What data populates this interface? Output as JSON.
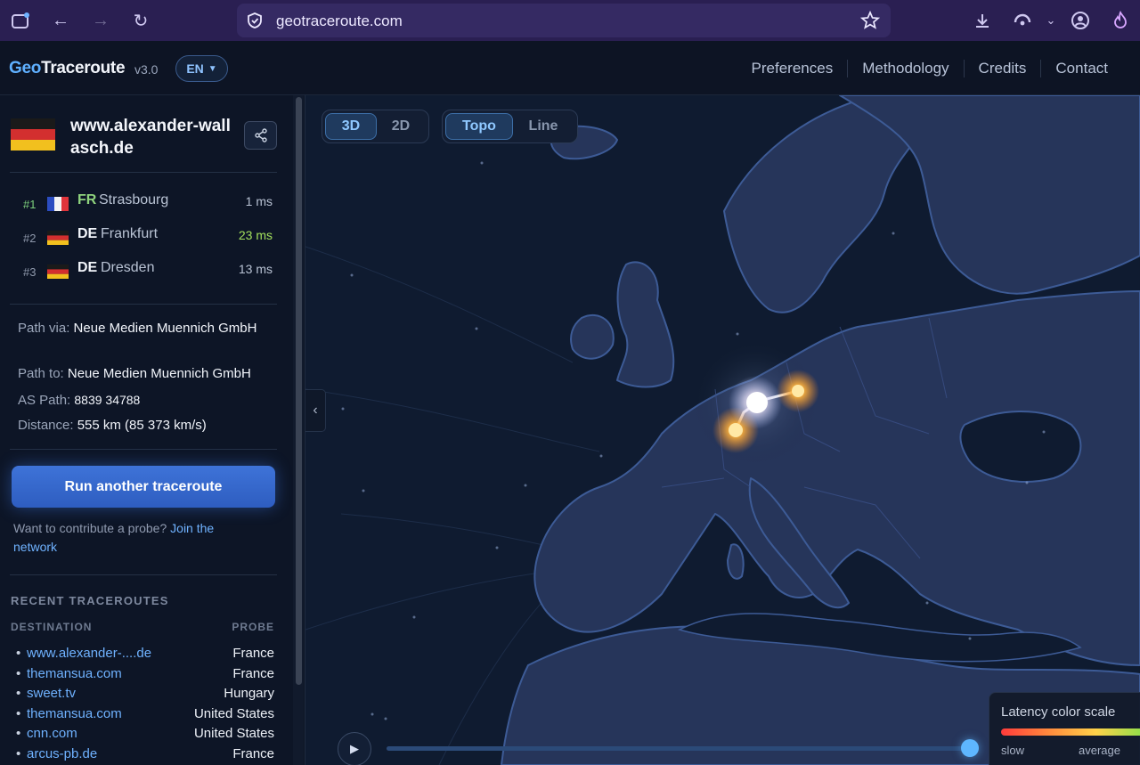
{
  "browser": {
    "url": "geotraceroute.com"
  },
  "header": {
    "logo_geo": "Geo",
    "logo_rest": "Traceroute",
    "version": "v3.0",
    "lang": "EN",
    "nav": [
      "Preferences",
      "Methodology",
      "Credits",
      "Contact"
    ]
  },
  "destination": {
    "name": "www.alexander-wallasch.de",
    "country": "DE"
  },
  "hops": [
    {
      "index": "#1",
      "cc": "FR",
      "city": "Strasbourg",
      "ms": "1 ms"
    },
    {
      "index": "#2",
      "cc": "DE",
      "city": "Frankfurt",
      "ms": "23 ms"
    },
    {
      "index": "#3",
      "cc": "DE",
      "city": "Dresden",
      "ms": "13 ms"
    }
  ],
  "info": {
    "path_via_label": "Path via:",
    "path_via": "Neue Medien Muennich GmbH",
    "path_to_label": "Path to:",
    "path_to": "Neue Medien Muennich GmbH",
    "as_path_label": "AS Path:",
    "as_path": "8839 34788",
    "distance_label": "Distance:",
    "distance": "555 km (85 373 km/s)"
  },
  "actions": {
    "run_label": "Run another traceroute",
    "contribute_text": "Want to contribute a probe?",
    "contribute_link": "Join the network"
  },
  "recent": {
    "title": "RECENT TRACEROUTES",
    "col_destination": "DESTINATION",
    "col_probe": "PROBE",
    "rows": [
      {
        "dest": "www.alexander-....de",
        "probe": "France"
      },
      {
        "dest": "themansua.com",
        "probe": "France"
      },
      {
        "dest": "sweet.tv",
        "probe": "Hungary"
      },
      {
        "dest": "themansua.com",
        "probe": "United States"
      },
      {
        "dest": "cnn.com",
        "probe": "United States"
      },
      {
        "dest": "arcus-pb.de",
        "probe": "France"
      }
    ]
  },
  "map": {
    "view_modes": [
      "3D",
      "2D"
    ],
    "view_active": "3D",
    "style_modes": [
      "Topo",
      "Line"
    ],
    "style_active": "Topo",
    "timeline_progress": 1.0,
    "legend_title": "Latency color scale",
    "legend_slow": "slow",
    "legend_average": "average"
  }
}
